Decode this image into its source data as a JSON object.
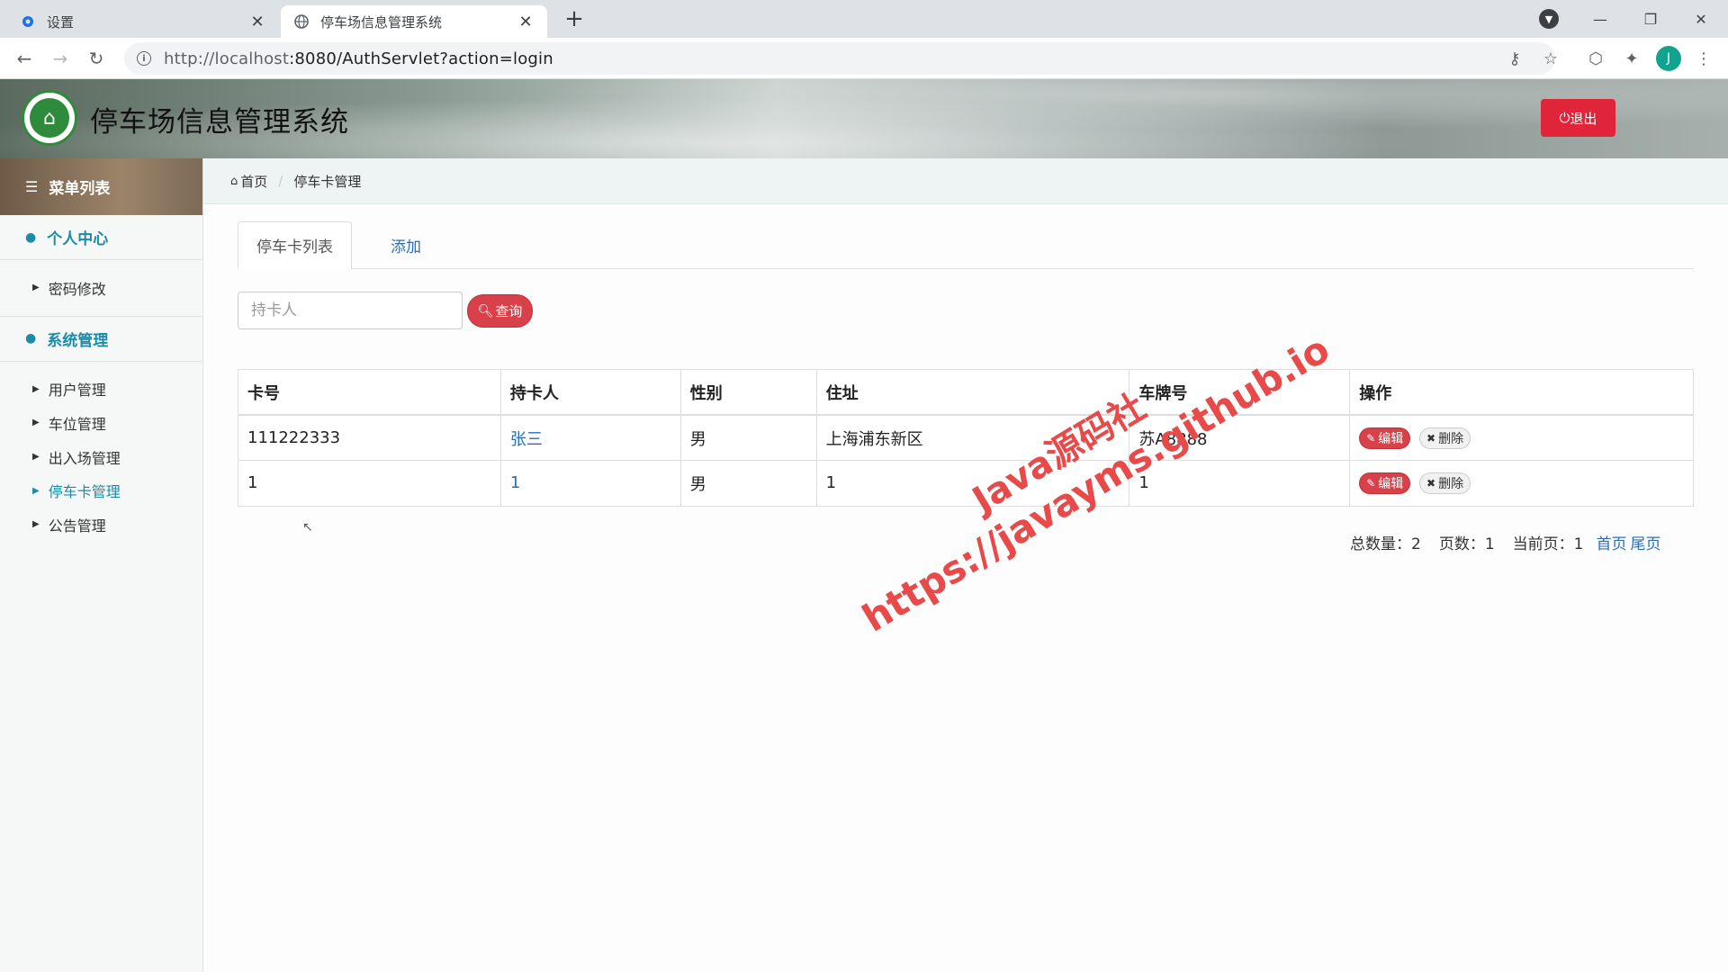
{
  "browser": {
    "tabs": [
      {
        "title": "设置",
        "icon": "gear-icon",
        "active": false
      },
      {
        "title": "停车场信息管理系统",
        "icon": "globe-icon",
        "active": true
      }
    ],
    "url_host": "http://localhost",
    "url_rest": ":8080/AuthServlet?action=login",
    "profile_initial": "J"
  },
  "header": {
    "title": "停车场信息管理系统",
    "logout_label": "退出"
  },
  "sidebar": {
    "heading": "菜单列表",
    "sections": [
      {
        "label": "个人中心",
        "items": [
          "密码修改"
        ]
      },
      {
        "label": "系统管理",
        "items": [
          "用户管理",
          "车位管理",
          "出入场管理",
          "停车卡管理",
          "公告管理"
        ]
      }
    ],
    "active_item": "停车卡管理"
  },
  "breadcrumb": {
    "home": "首页",
    "current": "停车卡管理"
  },
  "main": {
    "tabs": [
      {
        "label": "停车卡列表",
        "active": true
      },
      {
        "label": "添加",
        "active": false
      }
    ],
    "search": {
      "placeholder": "持卡人",
      "button_label": "查询"
    },
    "table": {
      "headers": [
        "卡号",
        "持卡人",
        "性别",
        "住址",
        "车牌号",
        "操作"
      ],
      "rows": [
        {
          "card": "111222333",
          "holder": "张三",
          "gender": "男",
          "address": "上海浦东新区",
          "plate": "苏A8888"
        },
        {
          "card": "1",
          "holder": "1",
          "gender": "男",
          "address": "1",
          "plate": "1"
        }
      ],
      "edit_label": "编辑",
      "delete_label": "删除"
    },
    "pager": {
      "total": "总数量：2",
      "pages": "页数：1",
      "current": "当前页：1",
      "first": "首页",
      "last": "尾页"
    }
  },
  "watermark": {
    "line1": "Java源码社",
    "line2": "https://javayms.github.io"
  },
  "colors": {
    "accent_teal": "#1d8aa8",
    "danger_red": "#e0243a",
    "link_blue": "#2a6ebb"
  }
}
